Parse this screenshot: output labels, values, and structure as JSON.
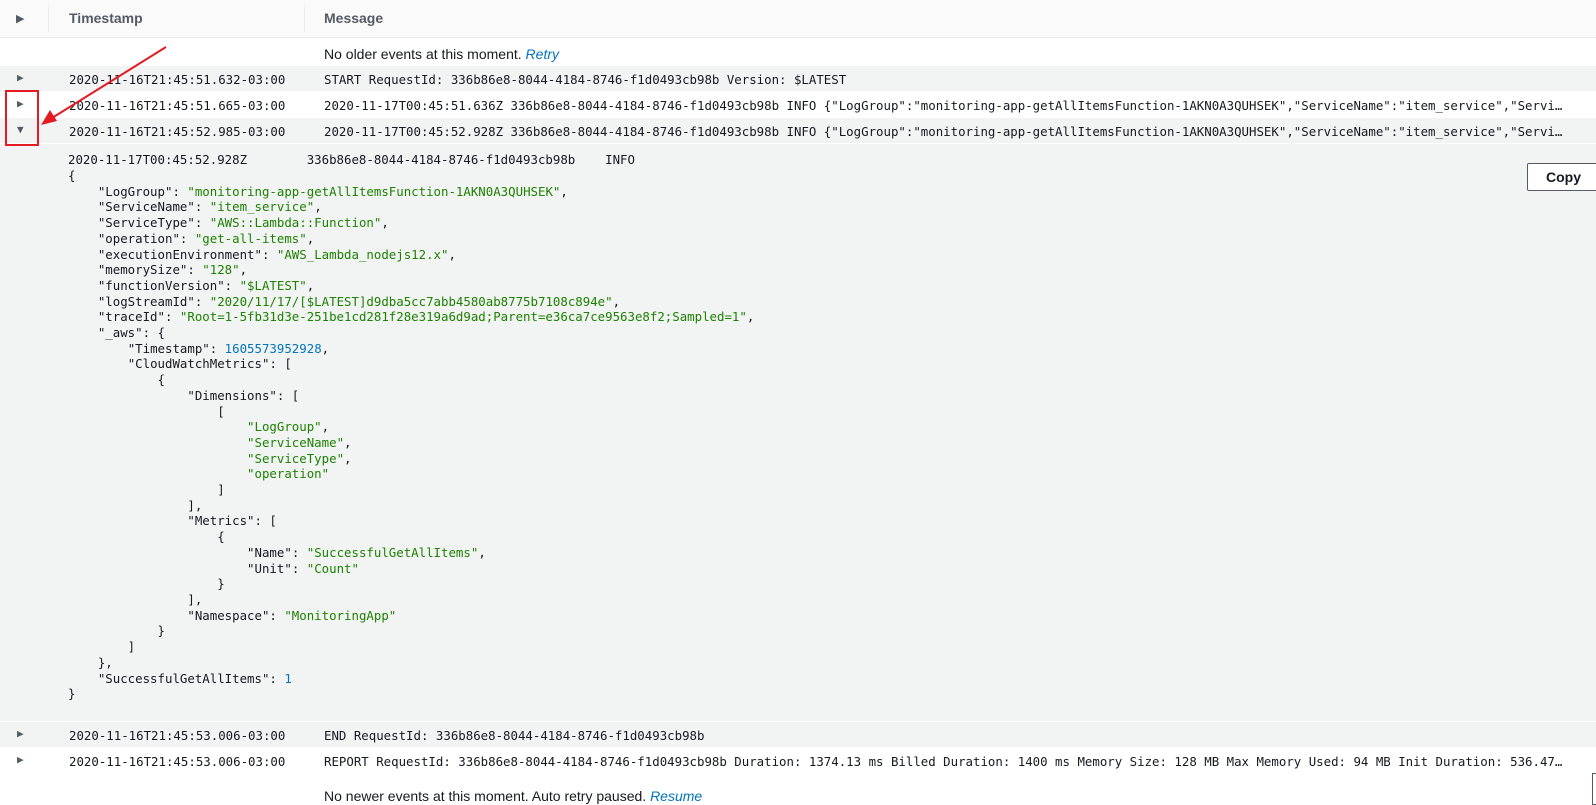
{
  "header": {
    "col_timestamp": "Timestamp",
    "col_message": "Message"
  },
  "older_notice": {
    "text": "No older events at this moment.",
    "link": "Retry"
  },
  "rows_top": [
    {
      "ts": "2020-11-16T21:45:51.632-03:00",
      "msg": "START RequestId: 336b86e8-8044-4184-8746-f1d0493cb98b Version: $LATEST"
    },
    {
      "ts": "2020-11-16T21:45:51.665-03:00",
      "msg": "2020-11-17T00:45:51.636Z 336b86e8-8044-4184-8746-f1d0493cb98b INFO {\"LogGroup\":\"monitoring-app-getAllItemsFunction-1AKN0A3QUHSEK\",\"ServiceName\":\"item_service\",\"ServiceType\":\"..."
    },
    {
      "ts": "2020-11-16T21:45:52.985-03:00",
      "msg": "2020-11-17T00:45:52.928Z 336b86e8-8044-4184-8746-f1d0493cb98b INFO {\"LogGroup\":\"monitoring-app-getAllItemsFunction-1AKN0A3QUHSEK\",\"ServiceName\":\"item_service\",\"ServiceType\":\"..."
    }
  ],
  "expanded": {
    "head": "2020-11-17T00:45:52.928Z        336b86e8-8044-4184-8746-f1d0493cb98b    INFO",
    "copy_label": "Copy",
    "log_group": "\"monitoring-app-getAllItemsFunction-1AKN0A3QUHSEK\"",
    "service_name": "\"item_service\"",
    "service_type": "\"AWS::Lambda::Function\"",
    "operation": "\"get-all-items\"",
    "execution_environment": "\"AWS_Lambda_nodejs12.x\"",
    "memory_size": "\"128\"",
    "function_version": "\"$LATEST\"",
    "log_stream_id": "\"2020/11/17/[$LATEST]d9dba5cc7abb4580ab8775b7108c894e\"",
    "trace_id": "\"Root=1-5fb31d3e-251be1cd281f28e319a6d9ad;Parent=e36ca7ce9563e8f2;Sampled=1\"",
    "aws_timestamp": "1605573952928",
    "dimensions": [
      "\"LogGroup\"",
      "\"ServiceName\"",
      "\"ServiceType\"",
      "\"operation\""
    ],
    "metric_name": "\"SuccessfulGetAllItems\"",
    "metric_unit": "\"Count\"",
    "namespace": "\"MonitoringApp\"",
    "successful_count": "1"
  },
  "rows_bottom": [
    {
      "ts": "2020-11-16T21:45:53.006-03:00",
      "msg": "END RequestId: 336b86e8-8044-4184-8746-f1d0493cb98b"
    },
    {
      "ts": "2020-11-16T21:45:53.006-03:00",
      "msg": "REPORT RequestId: 336b86e8-8044-4184-8746-f1d0493cb98b Duration: 1374.13 ms Billed Duration: 1400 ms Memory Size: 128 MB Max Memory Used: 94 MB Init Duration: 536.47 ms XRAY ..."
    }
  ],
  "newer_notice": {
    "text": "No newer events at this moment. Auto retry paused.",
    "link": "Resume"
  },
  "icons": {
    "collapsed": "caret-right-icon",
    "expanded": "caret-down-icon"
  },
  "colors": {
    "annotation": "#e41b23",
    "json_string": "#1d8102",
    "json_number": "#0073bb"
  }
}
